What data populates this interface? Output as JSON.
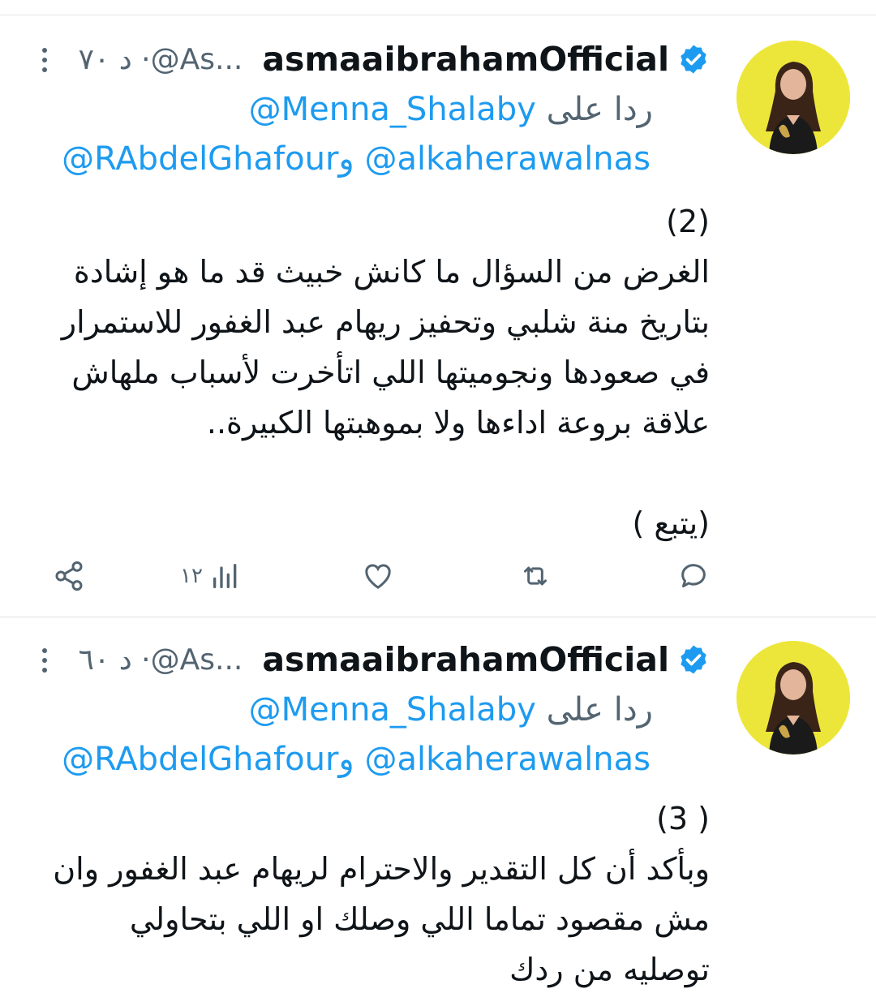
{
  "tweets": [
    {
      "name": "asmaaibrahamOfficial",
      "meta": "د ٧٠ ·@As...",
      "reply_label": "ردا على",
      "reply_handle": "@Menna_Shalaby",
      "mention_1": "@RAbdelGhafour",
      "mention_conj": "و",
      "mention_2": "@alkaherawalnas",
      "lines": [
        "(2)",
        "الغرض من السؤال ما كانش خبيث قد ما هو إشادة",
        "بتاريخ منة شلبي وتحفيز ريهام عبد الغفور للاستمرار",
        "في صعودها ونجوميتها اللي اتأخرت لأسباب ملهاش",
        "علاقة بروعة اداءها ولا بموهبتها الكبيرة..",
        "",
        "(يتبع )"
      ],
      "views": "١٢",
      "icons": {
        "avatar": "avatar",
        "verified": "verified-badge-icon",
        "more": "more-vertical-icon"
      }
    },
    {
      "name": "asmaaibrahamOfficial",
      "meta": "د ٦٠ ·@As...",
      "reply_label": "ردا على",
      "reply_handle": "@Menna_Shalaby",
      "mention_1": "@RAbdelGhafour",
      "mention_conj": "و",
      "mention_2": "@alkaherawalnas",
      "lines": [
        "( 3)",
        "وبأكد أن كل التقدير والاحترام لريهام عبد الغفور وان",
        "مش مقصود تماما اللي وصلك او اللي بتحاولي",
        "توصليه من ردك"
      ]
    }
  ],
  "colors": {
    "accent": "#1d9bf0",
    "secondary": "#536471",
    "avatar_bg": "#ede63a"
  }
}
